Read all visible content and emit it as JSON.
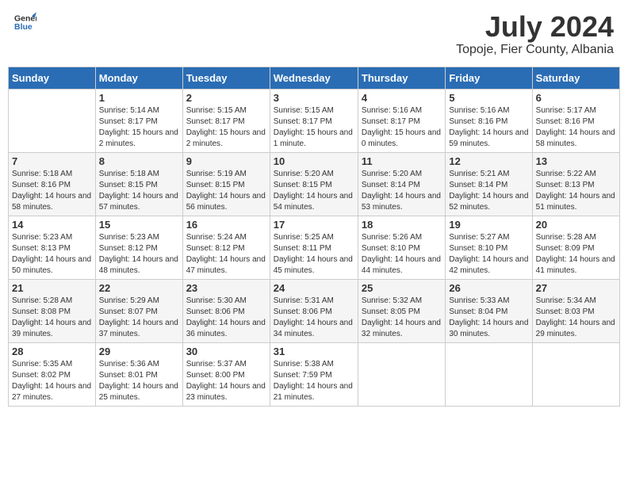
{
  "logo": {
    "text_general": "General",
    "text_blue": "Blue"
  },
  "header": {
    "month": "July 2024",
    "location": "Topoje, Fier County, Albania"
  },
  "days_of_week": [
    "Sunday",
    "Monday",
    "Tuesday",
    "Wednesday",
    "Thursday",
    "Friday",
    "Saturday"
  ],
  "weeks": [
    [
      {
        "day": "",
        "sunrise": "",
        "sunset": "",
        "daylight": ""
      },
      {
        "day": "1",
        "sunrise": "Sunrise: 5:14 AM",
        "sunset": "Sunset: 8:17 PM",
        "daylight": "Daylight: 15 hours and 2 minutes."
      },
      {
        "day": "2",
        "sunrise": "Sunrise: 5:15 AM",
        "sunset": "Sunset: 8:17 PM",
        "daylight": "Daylight: 15 hours and 2 minutes."
      },
      {
        "day": "3",
        "sunrise": "Sunrise: 5:15 AM",
        "sunset": "Sunset: 8:17 PM",
        "daylight": "Daylight: 15 hours and 1 minute."
      },
      {
        "day": "4",
        "sunrise": "Sunrise: 5:16 AM",
        "sunset": "Sunset: 8:17 PM",
        "daylight": "Daylight: 15 hours and 0 minutes."
      },
      {
        "day": "5",
        "sunrise": "Sunrise: 5:16 AM",
        "sunset": "Sunset: 8:16 PM",
        "daylight": "Daylight: 14 hours and 59 minutes."
      },
      {
        "day": "6",
        "sunrise": "Sunrise: 5:17 AM",
        "sunset": "Sunset: 8:16 PM",
        "daylight": "Daylight: 14 hours and 58 minutes."
      }
    ],
    [
      {
        "day": "7",
        "sunrise": "Sunrise: 5:18 AM",
        "sunset": "Sunset: 8:16 PM",
        "daylight": "Daylight: 14 hours and 58 minutes."
      },
      {
        "day": "8",
        "sunrise": "Sunrise: 5:18 AM",
        "sunset": "Sunset: 8:15 PM",
        "daylight": "Daylight: 14 hours and 57 minutes."
      },
      {
        "day": "9",
        "sunrise": "Sunrise: 5:19 AM",
        "sunset": "Sunset: 8:15 PM",
        "daylight": "Daylight: 14 hours and 56 minutes."
      },
      {
        "day": "10",
        "sunrise": "Sunrise: 5:20 AM",
        "sunset": "Sunset: 8:15 PM",
        "daylight": "Daylight: 14 hours and 54 minutes."
      },
      {
        "day": "11",
        "sunrise": "Sunrise: 5:20 AM",
        "sunset": "Sunset: 8:14 PM",
        "daylight": "Daylight: 14 hours and 53 minutes."
      },
      {
        "day": "12",
        "sunrise": "Sunrise: 5:21 AM",
        "sunset": "Sunset: 8:14 PM",
        "daylight": "Daylight: 14 hours and 52 minutes."
      },
      {
        "day": "13",
        "sunrise": "Sunrise: 5:22 AM",
        "sunset": "Sunset: 8:13 PM",
        "daylight": "Daylight: 14 hours and 51 minutes."
      }
    ],
    [
      {
        "day": "14",
        "sunrise": "Sunrise: 5:23 AM",
        "sunset": "Sunset: 8:13 PM",
        "daylight": "Daylight: 14 hours and 50 minutes."
      },
      {
        "day": "15",
        "sunrise": "Sunrise: 5:23 AM",
        "sunset": "Sunset: 8:12 PM",
        "daylight": "Daylight: 14 hours and 48 minutes."
      },
      {
        "day": "16",
        "sunrise": "Sunrise: 5:24 AM",
        "sunset": "Sunset: 8:12 PM",
        "daylight": "Daylight: 14 hours and 47 minutes."
      },
      {
        "day": "17",
        "sunrise": "Sunrise: 5:25 AM",
        "sunset": "Sunset: 8:11 PM",
        "daylight": "Daylight: 14 hours and 45 minutes."
      },
      {
        "day": "18",
        "sunrise": "Sunrise: 5:26 AM",
        "sunset": "Sunset: 8:10 PM",
        "daylight": "Daylight: 14 hours and 44 minutes."
      },
      {
        "day": "19",
        "sunrise": "Sunrise: 5:27 AM",
        "sunset": "Sunset: 8:10 PM",
        "daylight": "Daylight: 14 hours and 42 minutes."
      },
      {
        "day": "20",
        "sunrise": "Sunrise: 5:28 AM",
        "sunset": "Sunset: 8:09 PM",
        "daylight": "Daylight: 14 hours and 41 minutes."
      }
    ],
    [
      {
        "day": "21",
        "sunrise": "Sunrise: 5:28 AM",
        "sunset": "Sunset: 8:08 PM",
        "daylight": "Daylight: 14 hours and 39 minutes."
      },
      {
        "day": "22",
        "sunrise": "Sunrise: 5:29 AM",
        "sunset": "Sunset: 8:07 PM",
        "daylight": "Daylight: 14 hours and 37 minutes."
      },
      {
        "day": "23",
        "sunrise": "Sunrise: 5:30 AM",
        "sunset": "Sunset: 8:06 PM",
        "daylight": "Daylight: 14 hours and 36 minutes."
      },
      {
        "day": "24",
        "sunrise": "Sunrise: 5:31 AM",
        "sunset": "Sunset: 8:06 PM",
        "daylight": "Daylight: 14 hours and 34 minutes."
      },
      {
        "day": "25",
        "sunrise": "Sunrise: 5:32 AM",
        "sunset": "Sunset: 8:05 PM",
        "daylight": "Daylight: 14 hours and 32 minutes."
      },
      {
        "day": "26",
        "sunrise": "Sunrise: 5:33 AM",
        "sunset": "Sunset: 8:04 PM",
        "daylight": "Daylight: 14 hours and 30 minutes."
      },
      {
        "day": "27",
        "sunrise": "Sunrise: 5:34 AM",
        "sunset": "Sunset: 8:03 PM",
        "daylight": "Daylight: 14 hours and 29 minutes."
      }
    ],
    [
      {
        "day": "28",
        "sunrise": "Sunrise: 5:35 AM",
        "sunset": "Sunset: 8:02 PM",
        "daylight": "Daylight: 14 hours and 27 minutes."
      },
      {
        "day": "29",
        "sunrise": "Sunrise: 5:36 AM",
        "sunset": "Sunset: 8:01 PM",
        "daylight": "Daylight: 14 hours and 25 minutes."
      },
      {
        "day": "30",
        "sunrise": "Sunrise: 5:37 AM",
        "sunset": "Sunset: 8:00 PM",
        "daylight": "Daylight: 14 hours and 23 minutes."
      },
      {
        "day": "31",
        "sunrise": "Sunrise: 5:38 AM",
        "sunset": "Sunset: 7:59 PM",
        "daylight": "Daylight: 14 hours and 21 minutes."
      },
      {
        "day": "",
        "sunrise": "",
        "sunset": "",
        "daylight": ""
      },
      {
        "day": "",
        "sunrise": "",
        "sunset": "",
        "daylight": ""
      },
      {
        "day": "",
        "sunrise": "",
        "sunset": "",
        "daylight": ""
      }
    ]
  ]
}
